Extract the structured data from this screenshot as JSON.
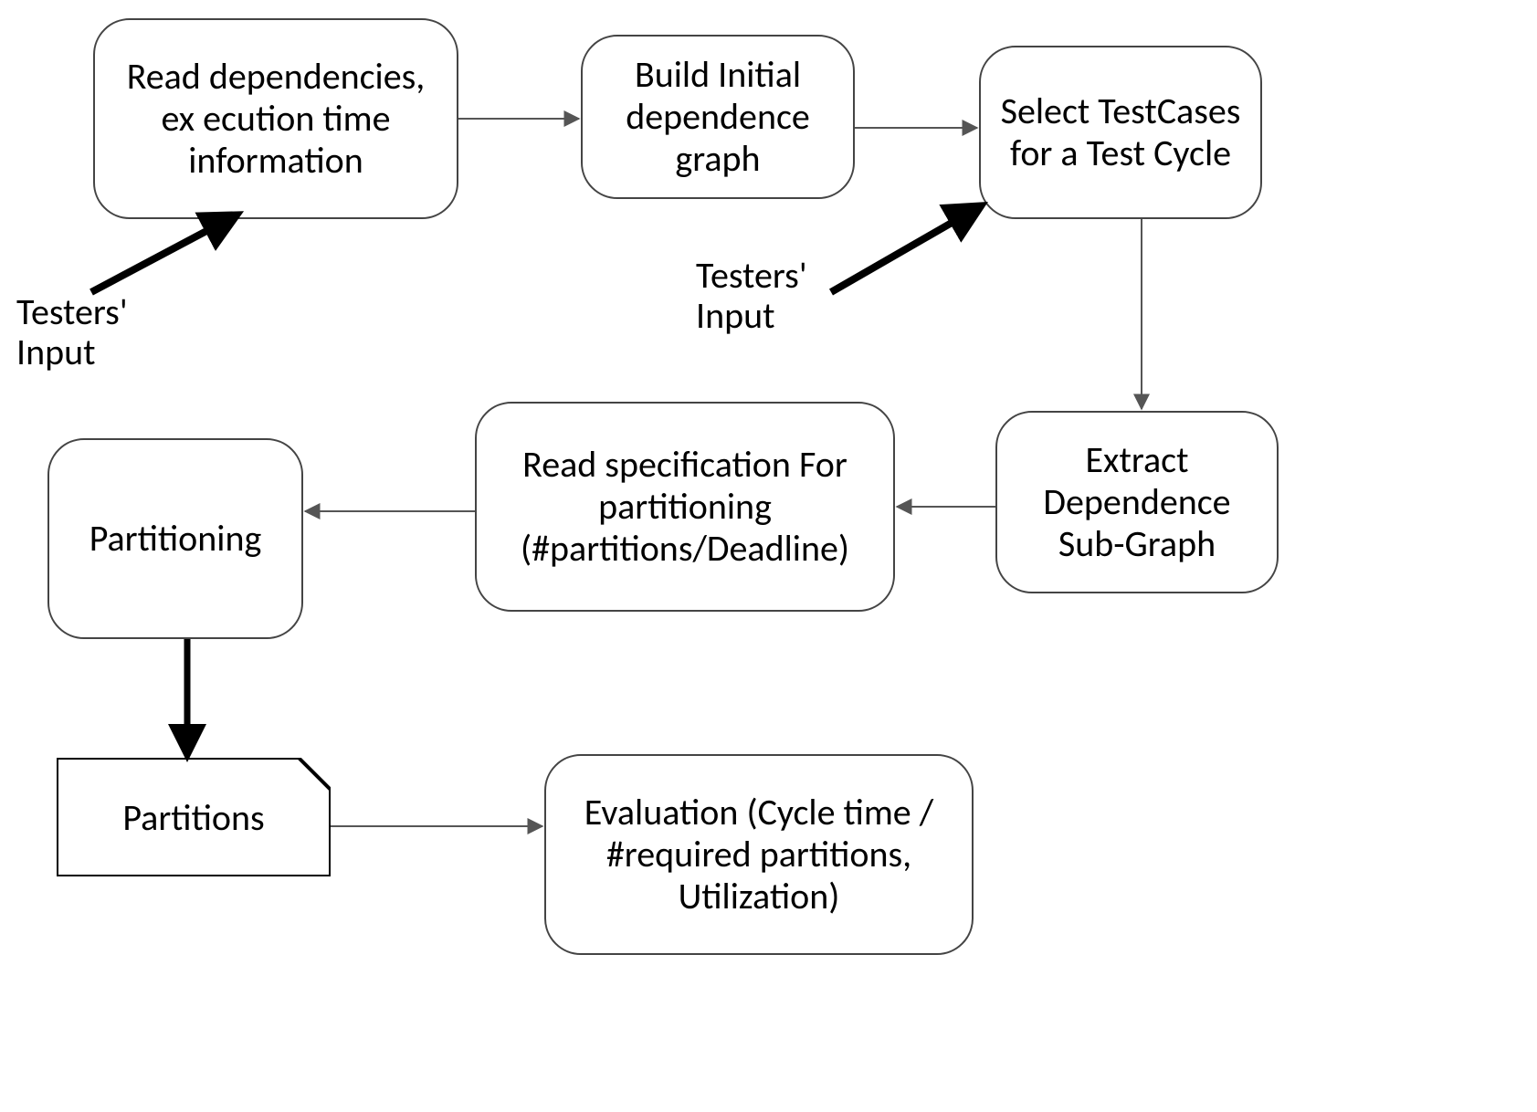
{
  "nodes": {
    "read_deps": "Read dependencies, ex ecution time information",
    "build_graph": "Build Initial dependence graph",
    "select_tc": "Select TestCases for a Test Cycle",
    "extract_sub": "Extract Dependence Sub-Graph",
    "read_spec": "Read specification For partitioning (#partitions/Deadline)",
    "partitioning": "Partitioning",
    "partitions": "Partitions",
    "evaluation": "Evaluation (Cycle time / #required partitions, Utilization)"
  },
  "labels": {
    "testers_input_1": "Testers' Input",
    "testers_input_2": "Testers' Input"
  }
}
